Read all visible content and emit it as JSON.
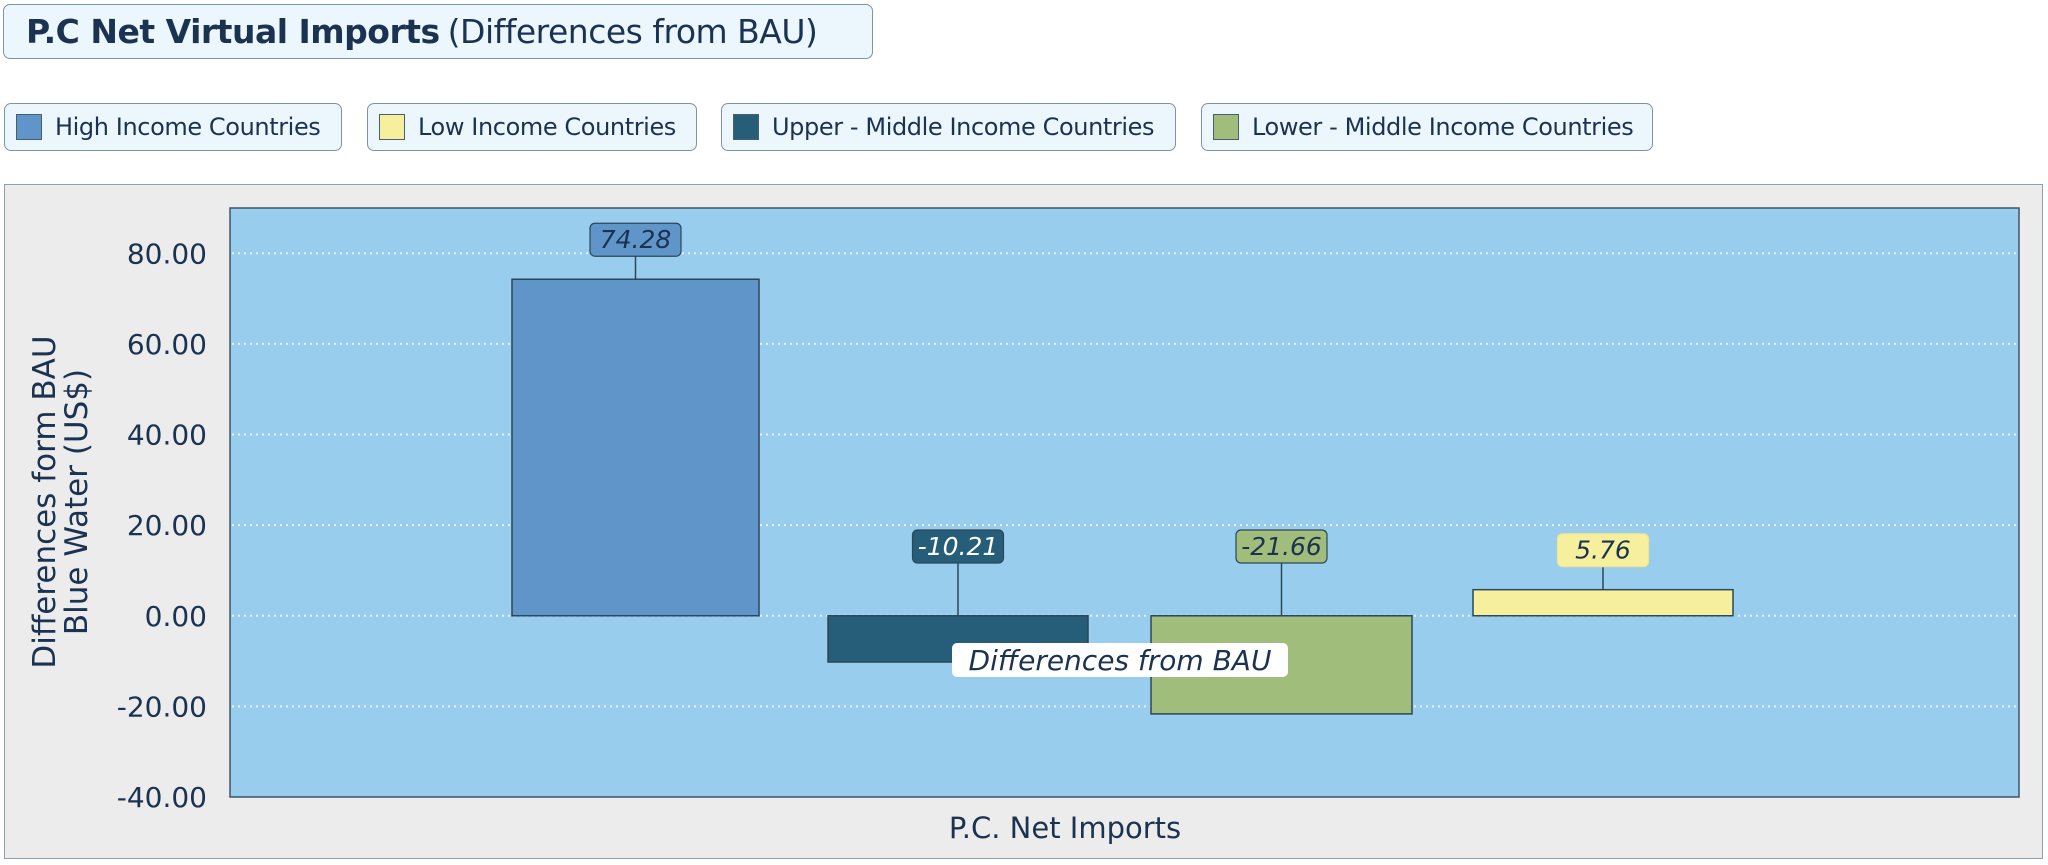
{
  "title": {
    "bold": "P.C Net Virtual Imports",
    "rest": "(Differences from BAU)"
  },
  "legend": [
    {
      "label": "High Income Countries",
      "color": "#6095c9"
    },
    {
      "label": "Low Income Countries",
      "color": "#f6ef9e"
    },
    {
      "label": "Upper - Middle Income Countries",
      "color": "#265e7a"
    },
    {
      "label": "Lower - Middle Income Countries",
      "color": "#a0bd7b"
    }
  ],
  "tooltip": "Differences from BAU",
  "chart_data": {
    "type": "bar",
    "title": "P.C Net Virtual Imports (Differences from BAU)",
    "xlabel": "P.C. Net Imports",
    "ylabel": [
      "Differences form BAU",
      "Blue Water (US$)"
    ],
    "ylim": [
      -40,
      90
    ],
    "yticks": [
      80,
      60,
      40,
      20,
      0,
      -20,
      -40
    ],
    "ytick_labels": [
      "80.00",
      "60.00",
      "40.00",
      "20.00",
      "0.00",
      "-20.00",
      "-40.00"
    ],
    "grid": true,
    "legend_position": "top-left",
    "categories": [
      "P.C. Net Imports"
    ],
    "series": [
      {
        "name": "High Income Countries",
        "values": [
          74.28
        ],
        "label": "74.28",
        "color": "#6095c9",
        "label_text_color": "#1b3350"
      },
      {
        "name": "Upper - Middle Income Countries",
        "values": [
          -10.21
        ],
        "label": "-10.21",
        "color": "#265e7a",
        "label_text_color": "#ffffff"
      },
      {
        "name": "Lower - Middle Income Countries",
        "values": [
          -21.66
        ],
        "label": "-21.66",
        "color": "#a0bd7b",
        "label_text_color": "#1b3350"
      },
      {
        "name": "Low Income Countries",
        "values": [
          5.76
        ],
        "label": "5.76",
        "color": "#f6ef9e",
        "label_text_color": "#1b3350"
      }
    ]
  }
}
